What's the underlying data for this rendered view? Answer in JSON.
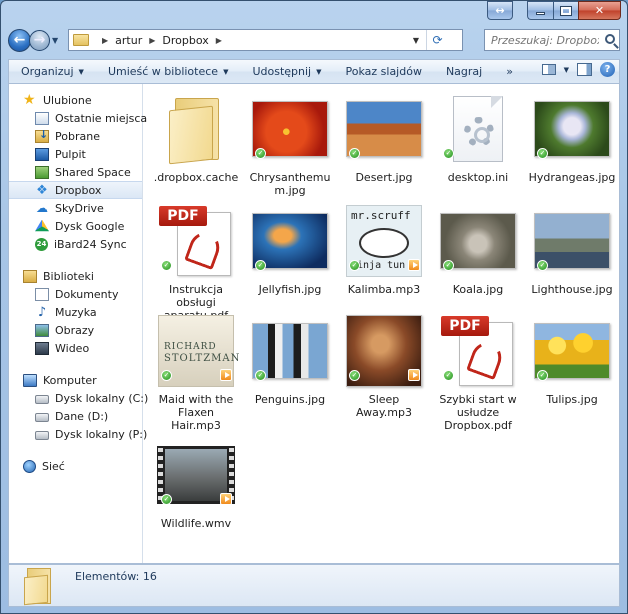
{
  "window": {
    "caption_buttons": [
      "restore",
      "minimize",
      "maximize",
      "close"
    ]
  },
  "address": {
    "crumbs": [
      "artur",
      "Dropbox"
    ],
    "search_placeholder": "Przeszukaj: Dropbox"
  },
  "toolbar": {
    "items": [
      "Organizuj",
      "Umieść w bibliotece",
      "Udostępnij",
      "Pokaz slajdów",
      "Nagraj"
    ],
    "more": "»"
  },
  "nav": {
    "favorites": {
      "label": "Ulubione",
      "items": [
        "Ostatnie miejsca",
        "Pobrane",
        "Pulpit",
        "Shared Space",
        "Dropbox",
        "SkyDrive",
        "Dysk Google",
        "iBard24 Sync"
      ]
    },
    "libraries": {
      "label": "Biblioteki",
      "items": [
        "Dokumenty",
        "Muzyka",
        "Obrazy",
        "Wideo"
      ]
    },
    "computer": {
      "label": "Komputer",
      "items": [
        "Dysk lokalny (C:)",
        "Dane (D:)",
        "Dysk lokalny (P:)"
      ]
    },
    "network": {
      "label": "Sieć"
    }
  },
  "files": [
    {
      "name": ".dropbox.cache",
      "kind": "folder"
    },
    {
      "name": "Chrysanthemum.jpg",
      "kind": "photo",
      "color": "#d8381c"
    },
    {
      "name": "Desert.jpg",
      "kind": "photo",
      "color": "#b8562a"
    },
    {
      "name": "desktop.ini",
      "kind": "ini"
    },
    {
      "name": "Hydrangeas.jpg",
      "kind": "photo",
      "color": "#5a7c3a"
    },
    {
      "name": "Instrukcja obsługi aparatu.pdf",
      "kind": "pdf"
    },
    {
      "name": "Jellyfish.jpg",
      "kind": "photo",
      "color": "#153f7a"
    },
    {
      "name": "Kalimba.mp3",
      "kind": "mp3",
      "cover_top": "mr.scruff",
      "cover_bottom": "ninja tun"
    },
    {
      "name": "Koala.jpg",
      "kind": "photo",
      "color": "#7c7a6c"
    },
    {
      "name": "Lighthouse.jpg",
      "kind": "photo",
      "color": "#6f86a0"
    },
    {
      "name": "Maid with the Flaxen Hair.mp3",
      "kind": "album",
      "cover_top": "RICHARD",
      "cover_bottom": "STOLTZMAN"
    },
    {
      "name": "Penguins.jpg",
      "kind": "photo",
      "color": "#5d8ab8"
    },
    {
      "name": "Sleep Away.mp3",
      "kind": "mp3photo",
      "color": "#6e3a22"
    },
    {
      "name": "Szybki start w usłudze Dropbox.pdf",
      "kind": "pdf"
    },
    {
      "name": "Tulips.jpg",
      "kind": "photo",
      "color": "#e4b81c"
    },
    {
      "name": "Wildlife.wmv",
      "kind": "video"
    }
  ],
  "details": {
    "count": "Elementów: 16"
  }
}
